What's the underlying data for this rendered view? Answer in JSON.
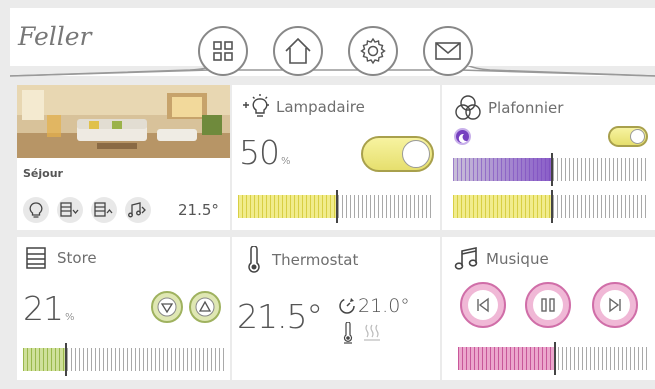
{
  "brand": {
    "logo": "Feller"
  },
  "nav": [
    {
      "name": "grid-icon"
    },
    {
      "name": "home-icon"
    },
    {
      "name": "gear-icon"
    },
    {
      "name": "mail-icon"
    }
  ],
  "tiles": {
    "room": {
      "name": "Séjour",
      "temp": "21.5°",
      "buttons": [
        "bulb-icon",
        "blind-down-icon",
        "blind-up-icon",
        "music-icon"
      ]
    },
    "lampadaire": {
      "title": "Lampadaire",
      "value": "50",
      "unit": "%",
      "on": true,
      "level": 0.5
    },
    "plafonnier": {
      "title": "Plafonnier",
      "on": true,
      "color_level": 0.5,
      "brightness_level": 0.5
    },
    "store": {
      "title": "Store",
      "value": "21",
      "unit": "%",
      "level": 0.21
    },
    "thermostat": {
      "title": "Thermostat",
      "current": "21.5°",
      "setpoint": "21.0°"
    },
    "musique": {
      "title": "Musique",
      "buttons": [
        "previous-icon",
        "pause-icon",
        "next-icon"
      ],
      "level": 0.5
    }
  },
  "colors": {
    "accent_yellow": "#f0ea85",
    "accent_green": "#b5cf7e",
    "accent_pink": "#e496c4",
    "accent_purple": "#8a5ec8"
  }
}
